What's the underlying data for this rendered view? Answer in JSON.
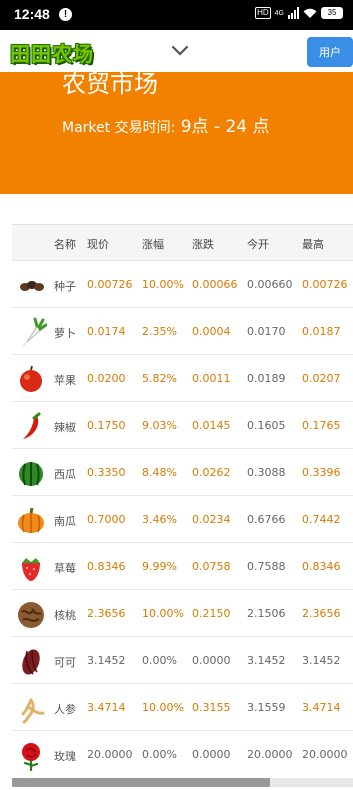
{
  "status_bar": {
    "time": "12:48",
    "notif": "!",
    "hd": "HD",
    "net": "4G",
    "battery": "35"
  },
  "header": {
    "logo_text": "田田农场",
    "user_label": "用户"
  },
  "banner": {
    "title": "农贸市场",
    "subtitle_prefix": "Market 交易时间:",
    "subtitle_hours": " 9点 - 24 点"
  },
  "table": {
    "headers": [
      "名称",
      "现价",
      "涨幅",
      "涨跌",
      "今开",
      "最高"
    ],
    "rows": [
      {
        "icon": "seed-icon",
        "name": "种子",
        "price": "0.00726",
        "pct": "10.00%",
        "change": "0.00066",
        "open": "0.00660",
        "high": "0.00726",
        "up": true
      },
      {
        "icon": "radish-icon",
        "name": "萝卜",
        "price": "0.0174",
        "pct": "2.35%",
        "change": "0.0004",
        "open": "0.0170",
        "high": "0.0187",
        "up": true
      },
      {
        "icon": "apple-icon",
        "name": "苹果",
        "price": "0.0200",
        "pct": "5.82%",
        "change": "0.0011",
        "open": "0.0189",
        "high": "0.0207",
        "up": true
      },
      {
        "icon": "chili-icon",
        "name": "辣椒",
        "price": "0.1750",
        "pct": "9.03%",
        "change": "0.0145",
        "open": "0.1605",
        "high": "0.1765",
        "up": true
      },
      {
        "icon": "watermelon-icon",
        "name": "西瓜",
        "price": "0.3350",
        "pct": "8.48%",
        "change": "0.0262",
        "open": "0.3088",
        "high": "0.3396",
        "up": true
      },
      {
        "icon": "pumpkin-icon",
        "name": "南瓜",
        "price": "0.7000",
        "pct": "3.46%",
        "change": "0.0234",
        "open": "0.6766",
        "high": "0.7442",
        "up": true
      },
      {
        "icon": "strawberry-icon",
        "name": "草莓",
        "price": "0.8346",
        "pct": "9.99%",
        "change": "0.0758",
        "open": "0.7588",
        "high": "0.8346",
        "up": true
      },
      {
        "icon": "walnut-icon",
        "name": "核桃",
        "price": "2.3656",
        "pct": "10.00%",
        "change": "0.2150",
        "open": "2.1506",
        "high": "2.3656",
        "up": true
      },
      {
        "icon": "cacao-icon",
        "name": "可可",
        "price": "3.1452",
        "pct": "0.00%",
        "change": "0.0000",
        "open": "3.1452",
        "high": "3.1452",
        "up": false
      },
      {
        "icon": "ginseng-icon",
        "name": "人参",
        "price": "3.4714",
        "pct": "10.00%",
        "change": "0.3155",
        "open": "3.1559",
        "high": "3.4714",
        "up": true
      },
      {
        "icon": "rose-icon",
        "name": "玫瑰",
        "price": "20.0000",
        "pct": "0.00%",
        "change": "0.0000",
        "open": "20.0000",
        "high": "20.0000",
        "up": false
      }
    ]
  },
  "colors": {
    "banner": "#f28100",
    "accent_up": "#d97a00",
    "user_button": "#3a8ee6"
  }
}
